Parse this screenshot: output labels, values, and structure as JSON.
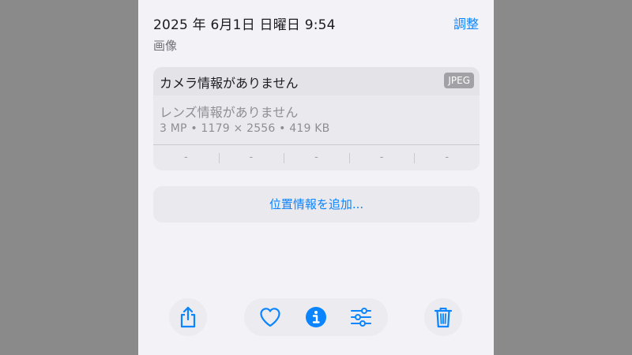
{
  "header": {
    "date": "2025 年 6月1日 日曜日 9:54",
    "adjust_label": "調整",
    "media_type": "画像"
  },
  "info_card": {
    "camera": "カメラ情報がありません",
    "format_badge": "JPEG",
    "lens": "レンズ情報がありません",
    "specs": "3 MP • 1179 × 2556 • 419 KB",
    "exif_values": [
      "-",
      "-",
      "-",
      "-",
      "-"
    ]
  },
  "location": {
    "add_label": "位置情報を追加..."
  },
  "toolbar": {
    "icons": [
      "share-icon",
      "heart-icon",
      "info-icon",
      "adjust-sliders-icon",
      "trash-icon"
    ],
    "accent_color": "#0a84ff"
  }
}
